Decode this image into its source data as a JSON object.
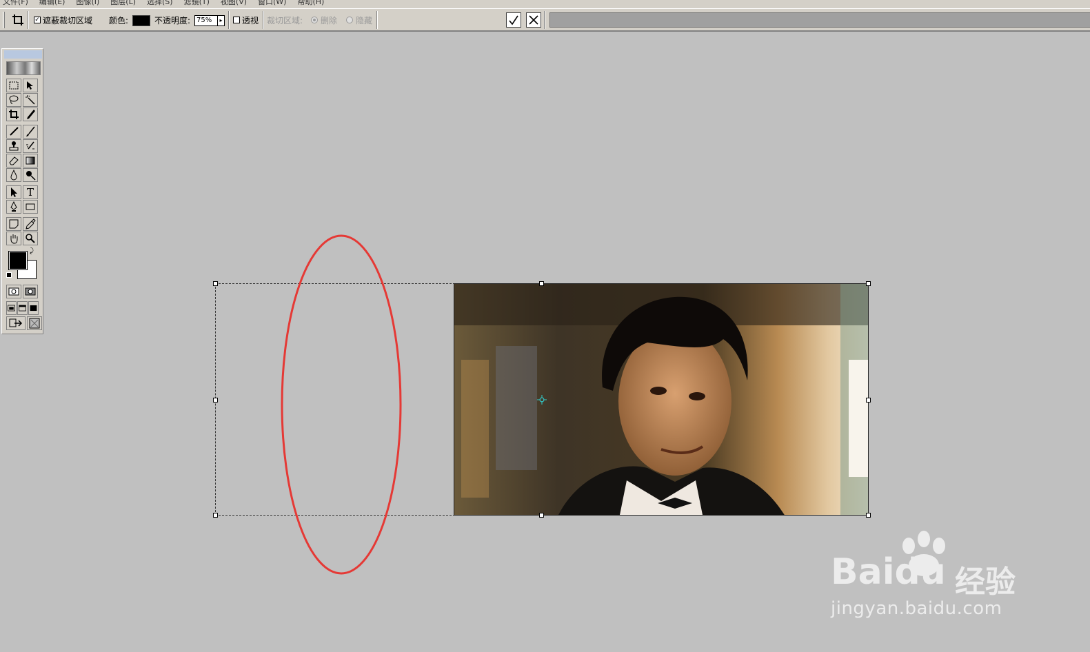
{
  "menu": [
    "文件(F)",
    "编辑(E)",
    "图像(I)",
    "图层(L)",
    "选择(S)",
    "滤镜(T)",
    "视图(V)",
    "窗口(W)",
    "帮助(H)"
  ],
  "options": {
    "shield_label": "遮蔽裁切区域",
    "shield_checked": true,
    "color_label": "颜色:",
    "opacity_label": "不透明度:",
    "opacity_value": "75%",
    "perspective_label": "透视",
    "perspective_checked": false,
    "crop_area_label": "裁切区域:",
    "delete_label": "删除",
    "hide_label": "隐藏",
    "shield_color": "#000000"
  },
  "toolbox": {
    "tools": [
      "marquee-icon",
      "move-icon",
      "lasso-icon",
      "magic-wand-icon",
      "crop-icon",
      "slice-icon",
      "healing-brush-icon",
      "brush-icon",
      "stamp-icon",
      "history-brush-icon",
      "eraser-icon",
      "gradient-icon",
      "blur-icon",
      "dodge-icon",
      "path-select-icon",
      "type-icon",
      "pen-icon",
      "rectangle-icon",
      "notes-icon",
      "eyedropper-icon",
      "hand-icon",
      "zoom-icon"
    ],
    "type_glyph": "T",
    "foreground": "#000000",
    "background": "#ffffff"
  },
  "watermark": {
    "logo": "Baidu",
    "cn": "经验",
    "url": "jingyan.baidu.com"
  },
  "colors": {
    "workspace": "#c0c0c0",
    "annotation": "#e53935"
  }
}
